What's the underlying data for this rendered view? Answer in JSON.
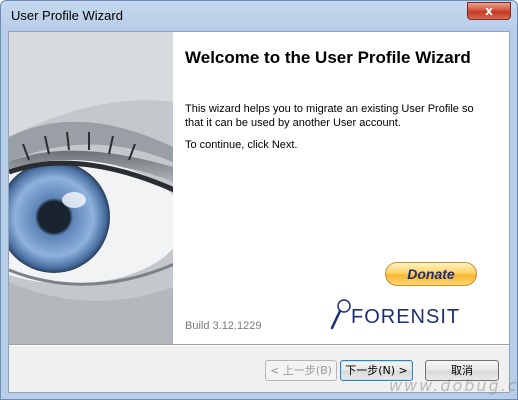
{
  "window": {
    "title": "User Profile Wizard",
    "close_icon": "close-icon",
    "close_glyph": "x"
  },
  "welcome": {
    "heading": "Welcome to the User Profile Wizard",
    "description": "This wizard helps you to migrate an existing User Profile so that it can be used by another User account.",
    "instruction": "To continue, click Next."
  },
  "donate": {
    "label": "Donate"
  },
  "build": {
    "text": "Build 3.12.1229"
  },
  "brand": {
    "logo_text": "FORENSIT",
    "logo_mark": "magnifier-icon",
    "color": "#1e2f7a"
  },
  "buttons": {
    "back": "< 上一步(B)",
    "next": "下一步(N) >",
    "cancel": "取消"
  },
  "watermark": {
    "text": "www.dobug.cc"
  },
  "colors": {
    "title_bar": "#c5d8ee",
    "close_button": "#c23b23",
    "donate_button": "#ffd466",
    "iris": "#6f94c6"
  }
}
